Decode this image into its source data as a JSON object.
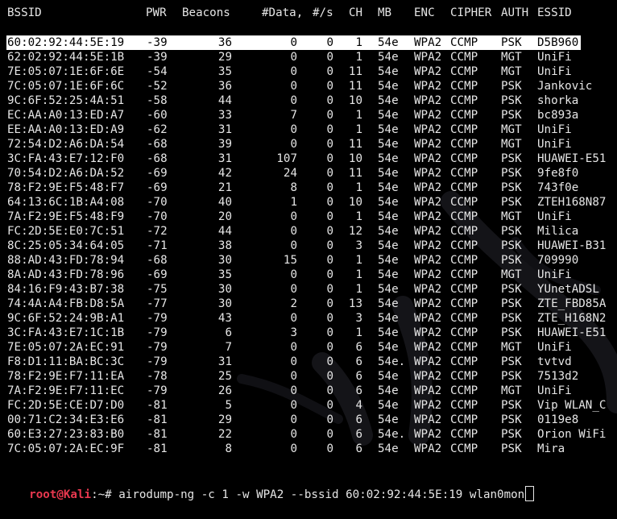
{
  "headers": {
    "bssid": "BSSID",
    "pwr": "PWR",
    "beacons": "Beacons",
    "data": "#Data,",
    "rate": "#/s",
    "ch": "CH",
    "mb": "MB",
    "enc": "ENC",
    "cipher": "CIPHER",
    "auth": "AUTH",
    "essid": "ESSID"
  },
  "rows": [
    {
      "bssid": "60:02:92:44:5E:19",
      "pwr": "-39",
      "beacons": "36",
      "data": "0",
      "rate": "0",
      "ch": "1",
      "mb": "54e",
      "enc": "WPA2",
      "cipher": "CCMP",
      "auth": "PSK",
      "essid": "D5B960",
      "selected": true
    },
    {
      "bssid": "62:02:92:44:5E:1B",
      "pwr": "-39",
      "beacons": "29",
      "data": "0",
      "rate": "0",
      "ch": "1",
      "mb": "54e",
      "enc": "WPA2",
      "cipher": "CCMP",
      "auth": "MGT",
      "essid": "UniFi"
    },
    {
      "bssid": "7E:05:07:1E:6F:6E",
      "pwr": "-54",
      "beacons": "35",
      "data": "0",
      "rate": "0",
      "ch": "11",
      "mb": "54e",
      "enc": "WPA2",
      "cipher": "CCMP",
      "auth": "MGT",
      "essid": "UniFi"
    },
    {
      "bssid": "7C:05:07:1E:6F:6C",
      "pwr": "-52",
      "beacons": "36",
      "data": "0",
      "rate": "0",
      "ch": "11",
      "mb": "54e",
      "enc": "WPA2",
      "cipher": "CCMP",
      "auth": "PSK",
      "essid": "Jankovic"
    },
    {
      "bssid": "9C:6F:52:25:4A:51",
      "pwr": "-58",
      "beacons": "44",
      "data": "0",
      "rate": "0",
      "ch": "10",
      "mb": "54e",
      "enc": "WPA2",
      "cipher": "CCMP",
      "auth": "PSK",
      "essid": "shorka"
    },
    {
      "bssid": "EC:AA:A0:13:ED:A7",
      "pwr": "-60",
      "beacons": "33",
      "data": "7",
      "rate": "0",
      "ch": "1",
      "mb": "54e",
      "enc": "WPA2",
      "cipher": "CCMP",
      "auth": "PSK",
      "essid": "bc893a"
    },
    {
      "bssid": "EE:AA:A0:13:ED:A9",
      "pwr": "-62",
      "beacons": "31",
      "data": "0",
      "rate": "0",
      "ch": "1",
      "mb": "54e",
      "enc": "WPA2",
      "cipher": "CCMP",
      "auth": "MGT",
      "essid": "UniFi"
    },
    {
      "bssid": "72:54:D2:A6:DA:54",
      "pwr": "-68",
      "beacons": "39",
      "data": "0",
      "rate": "0",
      "ch": "11",
      "mb": "54e",
      "enc": "WPA2",
      "cipher": "CCMP",
      "auth": "MGT",
      "essid": "UniFi"
    },
    {
      "bssid": "3C:FA:43:E7:12:F0",
      "pwr": "-68",
      "beacons": "31",
      "data": "107",
      "rate": "0",
      "ch": "10",
      "mb": "54e",
      "enc": "WPA2",
      "cipher": "CCMP",
      "auth": "PSK",
      "essid": "HUAWEI-E51"
    },
    {
      "bssid": "70:54:D2:A6:DA:52",
      "pwr": "-69",
      "beacons": "42",
      "data": "24",
      "rate": "0",
      "ch": "11",
      "mb": "54e",
      "enc": "WPA2",
      "cipher": "CCMP",
      "auth": "PSK",
      "essid": "9fe8f0"
    },
    {
      "bssid": "78:F2:9E:F5:48:F7",
      "pwr": "-69",
      "beacons": "21",
      "data": "8",
      "rate": "0",
      "ch": "1",
      "mb": "54e",
      "enc": "WPA2",
      "cipher": "CCMP",
      "auth": "PSK",
      "essid": "743f0e"
    },
    {
      "bssid": "64:13:6C:1B:A4:08",
      "pwr": "-70",
      "beacons": "40",
      "data": "1",
      "rate": "0",
      "ch": "10",
      "mb": "54e",
      "enc": "WPA2",
      "cipher": "CCMP",
      "auth": "PSK",
      "essid": "ZTEH168N87"
    },
    {
      "bssid": "7A:F2:9E:F5:48:F9",
      "pwr": "-70",
      "beacons": "20",
      "data": "0",
      "rate": "0",
      "ch": "1",
      "mb": "54e",
      "enc": "WPA2",
      "cipher": "CCMP",
      "auth": "MGT",
      "essid": "UniFi"
    },
    {
      "bssid": "FC:2D:5E:E0:7C:51",
      "pwr": "-72",
      "beacons": "44",
      "data": "0",
      "rate": "0",
      "ch": "12",
      "mb": "54e",
      "enc": "WPA2",
      "cipher": "CCMP",
      "auth": "PSK",
      "essid": "Milica"
    },
    {
      "bssid": "8C:25:05:34:64:05",
      "pwr": "-71",
      "beacons": "38",
      "data": "0",
      "rate": "0",
      "ch": "3",
      "mb": "54e",
      "enc": "WPA2",
      "cipher": "CCMP",
      "auth": "PSK",
      "essid": "HUAWEI-B31"
    },
    {
      "bssid": "88:AD:43:FD:78:94",
      "pwr": "-68",
      "beacons": "30",
      "data": "15",
      "rate": "0",
      "ch": "1",
      "mb": "54e",
      "enc": "WPA2",
      "cipher": "CCMP",
      "auth": "PSK",
      "essid": "709990"
    },
    {
      "bssid": "8A:AD:43:FD:78:96",
      "pwr": "-69",
      "beacons": "35",
      "data": "0",
      "rate": "0",
      "ch": "1",
      "mb": "54e",
      "enc": "WPA2",
      "cipher": "CCMP",
      "auth": "MGT",
      "essid": "UniFi"
    },
    {
      "bssid": "84:16:F9:43:B7:38",
      "pwr": "-75",
      "beacons": "30",
      "data": "0",
      "rate": "0",
      "ch": "1",
      "mb": "54e",
      "enc": "WPA2",
      "cipher": "CCMP",
      "auth": "PSK",
      "essid": "YUnetADSL"
    },
    {
      "bssid": "74:4A:A4:FB:D8:5A",
      "pwr": "-77",
      "beacons": "30",
      "data": "2",
      "rate": "0",
      "ch": "13",
      "mb": "54e",
      "enc": "WPA2",
      "cipher": "CCMP",
      "auth": "PSK",
      "essid": "ZTE_FBD85A"
    },
    {
      "bssid": "9C:6F:52:24:9B:A1",
      "pwr": "-79",
      "beacons": "43",
      "data": "0",
      "rate": "0",
      "ch": "3",
      "mb": "54e",
      "enc": "WPA2",
      "cipher": "CCMP",
      "auth": "PSK",
      "essid": "ZTE_H168N2"
    },
    {
      "bssid": "3C:FA:43:E7:1C:1B",
      "pwr": "-79",
      "beacons": "6",
      "data": "3",
      "rate": "0",
      "ch": "1",
      "mb": "54e",
      "enc": "WPA2",
      "cipher": "CCMP",
      "auth": "PSK",
      "essid": "HUAWEI-E51"
    },
    {
      "bssid": "7E:05:07:2A:EC:91",
      "pwr": "-79",
      "beacons": "7",
      "data": "0",
      "rate": "0",
      "ch": "6",
      "mb": "54e",
      "enc": "WPA2",
      "cipher": "CCMP",
      "auth": "MGT",
      "essid": "UniFi"
    },
    {
      "bssid": "F8:D1:11:BA:BC:3C",
      "pwr": "-79",
      "beacons": "31",
      "data": "0",
      "rate": "0",
      "ch": "6",
      "mb": "54e.",
      "enc": "WPA2",
      "cipher": "CCMP",
      "auth": "PSK",
      "essid": "tvtvd"
    },
    {
      "bssid": "78:F2:9E:F7:11:EA",
      "pwr": "-78",
      "beacons": "25",
      "data": "0",
      "rate": "0",
      "ch": "6",
      "mb": "54e",
      "enc": "WPA2",
      "cipher": "CCMP",
      "auth": "PSK",
      "essid": "7513d2"
    },
    {
      "bssid": "7A:F2:9E:F7:11:EC",
      "pwr": "-79",
      "beacons": "26",
      "data": "0",
      "rate": "0",
      "ch": "6",
      "mb": "54e",
      "enc": "WPA2",
      "cipher": "CCMP",
      "auth": "MGT",
      "essid": "UniFi"
    },
    {
      "bssid": "FC:2D:5E:CE:D7:D0",
      "pwr": "-81",
      "beacons": "5",
      "data": "0",
      "rate": "0",
      "ch": "4",
      "mb": "54e",
      "enc": "WPA2",
      "cipher": "CCMP",
      "auth": "PSK",
      "essid": "Vip WLAN_C"
    },
    {
      "bssid": "00:71:C2:34:E3:E6",
      "pwr": "-81",
      "beacons": "29",
      "data": "0",
      "rate": "0",
      "ch": "6",
      "mb": "54e",
      "enc": "WPA2",
      "cipher": "CCMP",
      "auth": "PSK",
      "essid": "0119e8"
    },
    {
      "bssid": "60:E3:27:23:83:B0",
      "pwr": "-81",
      "beacons": "22",
      "data": "0",
      "rate": "0",
      "ch": "6",
      "mb": "54e.",
      "enc": "WPA2",
      "cipher": "CCMP",
      "auth": "PSK",
      "essid": "Orion WiFi"
    },
    {
      "bssid": "7C:05:07:2A:EC:9F",
      "pwr": "-81",
      "beacons": "8",
      "data": "0",
      "rate": "0",
      "ch": "6",
      "mb": "54e",
      "enc": "WPA2",
      "cipher": "CCMP",
      "auth": "PSK",
      "essid": "Mira"
    }
  ],
  "prompt": {
    "user": "root",
    "at": "@",
    "host": "Kali",
    "path": ":~# ",
    "command": "airodump-ng -c 1 -w WPA2 --bssid 60:02:92:44:5E:19 wlan0mon"
  },
  "colors": {
    "background": "#000000",
    "text": "#e6e6e6",
    "prompt": "#e8384f",
    "selected_bg": "#ffffff"
  }
}
